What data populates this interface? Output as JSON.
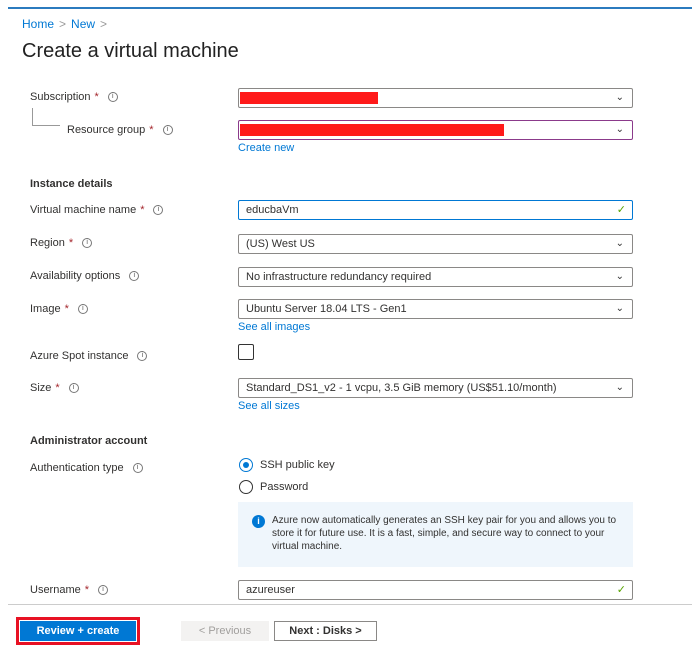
{
  "breadcrumb": {
    "items": [
      "Home",
      "New"
    ]
  },
  "page_title": "Create a virtual machine",
  "fields": {
    "subscription": {
      "label": "Subscription"
    },
    "resource_group": {
      "label": "Resource group",
      "create_new": "Create new"
    },
    "instance_details": "Instance details",
    "vm_name": {
      "label": "Virtual machine name",
      "value": "educbaVm"
    },
    "region": {
      "label": "Region",
      "value": "(US) West US"
    },
    "availability": {
      "label": "Availability options",
      "value": "No infrastructure redundancy required"
    },
    "image": {
      "label": "Image",
      "value": "Ubuntu Server 18.04 LTS - Gen1",
      "link": "See all images"
    },
    "spot": {
      "label": "Azure Spot instance",
      "checked": false
    },
    "size": {
      "label": "Size",
      "value": "Standard_DS1_v2 - 1 vcpu, 3.5 GiB memory (US$51.10/month)",
      "link": "See all sizes"
    },
    "admin_account": "Administrator account",
    "auth_type": {
      "label": "Authentication type",
      "options": [
        "SSH public key",
        "Password"
      ],
      "selected": "SSH public key"
    },
    "info_text": "Azure now automatically generates an SSH key pair for you and allows you to store it for future use. It is a fast, simple, and secure way to connect to your virtual machine.",
    "username": {
      "label": "Username",
      "value": "azureuser"
    }
  },
  "footer": {
    "review": "Review + create",
    "previous": "< Previous",
    "next": "Next : Disks >"
  },
  "colors": {
    "accent": "#0078d4",
    "highlight": "#e81123"
  }
}
